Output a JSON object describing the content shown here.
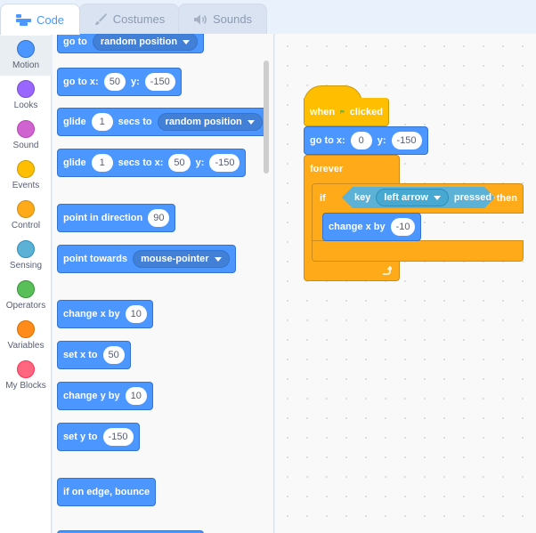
{
  "tabs": [
    {
      "label": "Code",
      "icon": "code-icon",
      "active": true
    },
    {
      "label": "Costumes",
      "icon": "brush-icon",
      "active": false
    },
    {
      "label": "Sounds",
      "icon": "speaker-icon",
      "active": false
    }
  ],
  "categories": [
    {
      "label": "Motion",
      "color": "#4c97ff",
      "selected": true
    },
    {
      "label": "Looks",
      "color": "#9966ff",
      "selected": false
    },
    {
      "label": "Sound",
      "color": "#cf63cf",
      "selected": false
    },
    {
      "label": "Events",
      "color": "#ffbf00",
      "selected": false
    },
    {
      "label": "Control",
      "color": "#ffab19",
      "selected": false
    },
    {
      "label": "Sensing",
      "color": "#5cb1d6",
      "selected": false
    },
    {
      "label": "Operators",
      "color": "#59c059",
      "selected": false
    },
    {
      "label": "Variables",
      "color": "#ff8c1a",
      "selected": false
    },
    {
      "label": "My Blocks",
      "color": "#ff6680",
      "selected": false
    }
  ],
  "palette": {
    "goto": {
      "label": "go to",
      "target": "random position"
    },
    "gotoxy": {
      "label": "go to x:",
      "x": "50",
      "ylabel": "y:",
      "y": "-150"
    },
    "glide_random": {
      "label": "glide",
      "secs": "1",
      "label2": "secs to",
      "target": "random position"
    },
    "glide_xy": {
      "label": "glide",
      "secs": "1",
      "label2": "secs to x:",
      "x": "50",
      "ylabel": "y:",
      "y": "-150"
    },
    "point_direction": {
      "label": "point in direction",
      "value": "90"
    },
    "point_towards": {
      "label": "point towards",
      "target": "mouse-pointer"
    },
    "change_x": {
      "label": "change x by",
      "value": "10"
    },
    "set_x": {
      "label": "set x to",
      "value": "50"
    },
    "change_y": {
      "label": "change y by",
      "value": "10"
    },
    "set_y": {
      "label": "set y to",
      "value": "-150"
    },
    "bounce": {
      "label": "if on edge, bounce"
    }
  },
  "script": {
    "hat": {
      "label1": "when",
      "label2": "clicked"
    },
    "gotoxy": {
      "label": "go to x:",
      "x": "0",
      "ylabel": "y:",
      "y": "-150"
    },
    "forever": {
      "label": "forever"
    },
    "if_block": {
      "label": "if",
      "then": "then"
    },
    "key_pressed": {
      "label": "key",
      "key": "left arrow",
      "suffix": "pressed?"
    },
    "change_x": {
      "label": "change x by",
      "value": "-10"
    }
  }
}
